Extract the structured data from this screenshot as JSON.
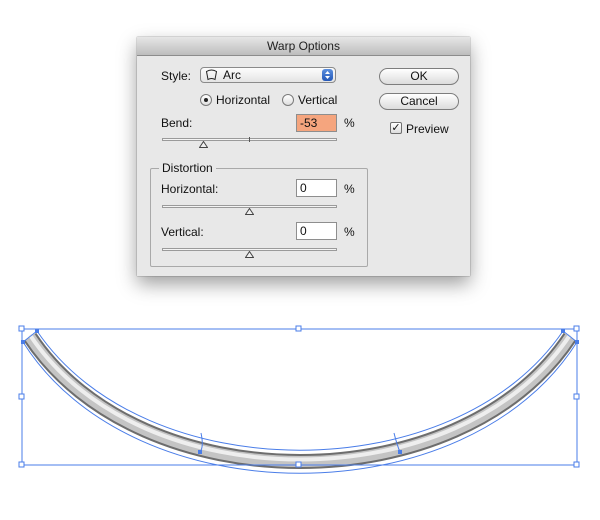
{
  "dialog": {
    "title": "Warp Options",
    "style_label": "Style:",
    "style_value": "Arc",
    "style_icon": "arc-warp-icon",
    "orientation": {
      "horizontal_label": "Horizontal",
      "vertical_label": "Vertical",
      "selected": "Horizontal"
    },
    "bend": {
      "label": "Bend:",
      "value": "-53",
      "unit": "%",
      "slider_value": -53
    },
    "distortion": {
      "title": "Distortion",
      "horizontal": {
        "label": "Horizontal:",
        "value": "0",
        "unit": "%",
        "slider_value": 0
      },
      "vertical": {
        "label": "Vertical:",
        "value": "0",
        "unit": "%",
        "slider_value": 0
      }
    },
    "buttons": {
      "ok": "OK",
      "cancel": "Cancel"
    },
    "preview": {
      "label": "Preview",
      "checked": true
    }
  },
  "artwork": {
    "shape": "warped-tube-arc",
    "selection_color": "#4a7de8",
    "tube_color": "#9d9d9d"
  }
}
